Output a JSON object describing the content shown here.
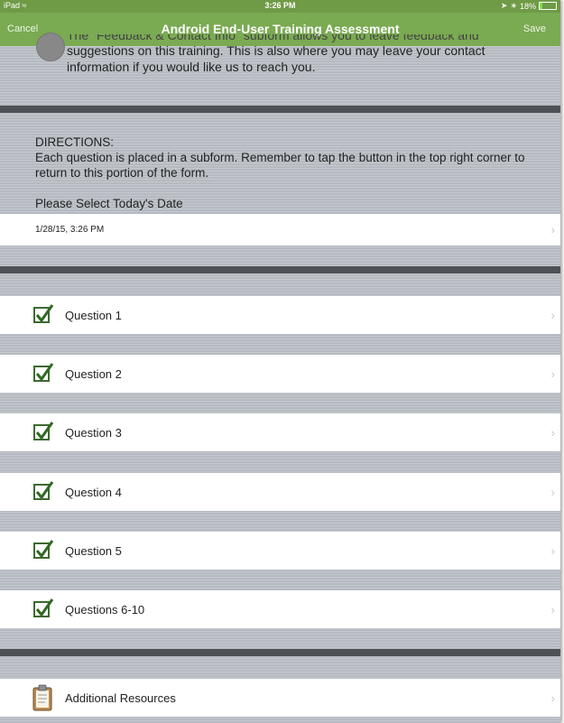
{
  "status_bar": {
    "carrier": "iPad",
    "time": "3:26 PM",
    "battery_text": "18%",
    "battery_level": 0.18
  },
  "nav": {
    "cancel_label": "Cancel",
    "title": "Android End-User Training Assessment",
    "save_label": "Save"
  },
  "intro": {
    "partial_line": "The \"Feedback & Contact Info\" subform allows you to leave feedback and",
    "text": "suggestions on this training.  This is also where you may leave your contact information if you would like us to reach you."
  },
  "directions": {
    "heading": "DIRECTIONS:",
    "body": "Each question is placed in a subform.  Remember to tap the button in the top right corner to return to this portion of the form."
  },
  "date_field": {
    "label": "Please Select Today's Date",
    "value": "1/28/15, 3:26 PM"
  },
  "questions": [
    {
      "label": "Question 1"
    },
    {
      "label": "Question 2"
    },
    {
      "label": "Question 3"
    },
    {
      "label": "Question 4"
    },
    {
      "label": "Question 5"
    },
    {
      "label": "Questions 6-10"
    }
  ],
  "resources": {
    "label": "Additional Resources"
  },
  "icons": {
    "chevron": "chevron-right-icon",
    "checkbox": "checkbox-checked-icon",
    "clipboard": "clipboard-icon"
  },
  "colors": {
    "nav_green": "#7aaa52",
    "check_green": "#3d6a2f"
  }
}
